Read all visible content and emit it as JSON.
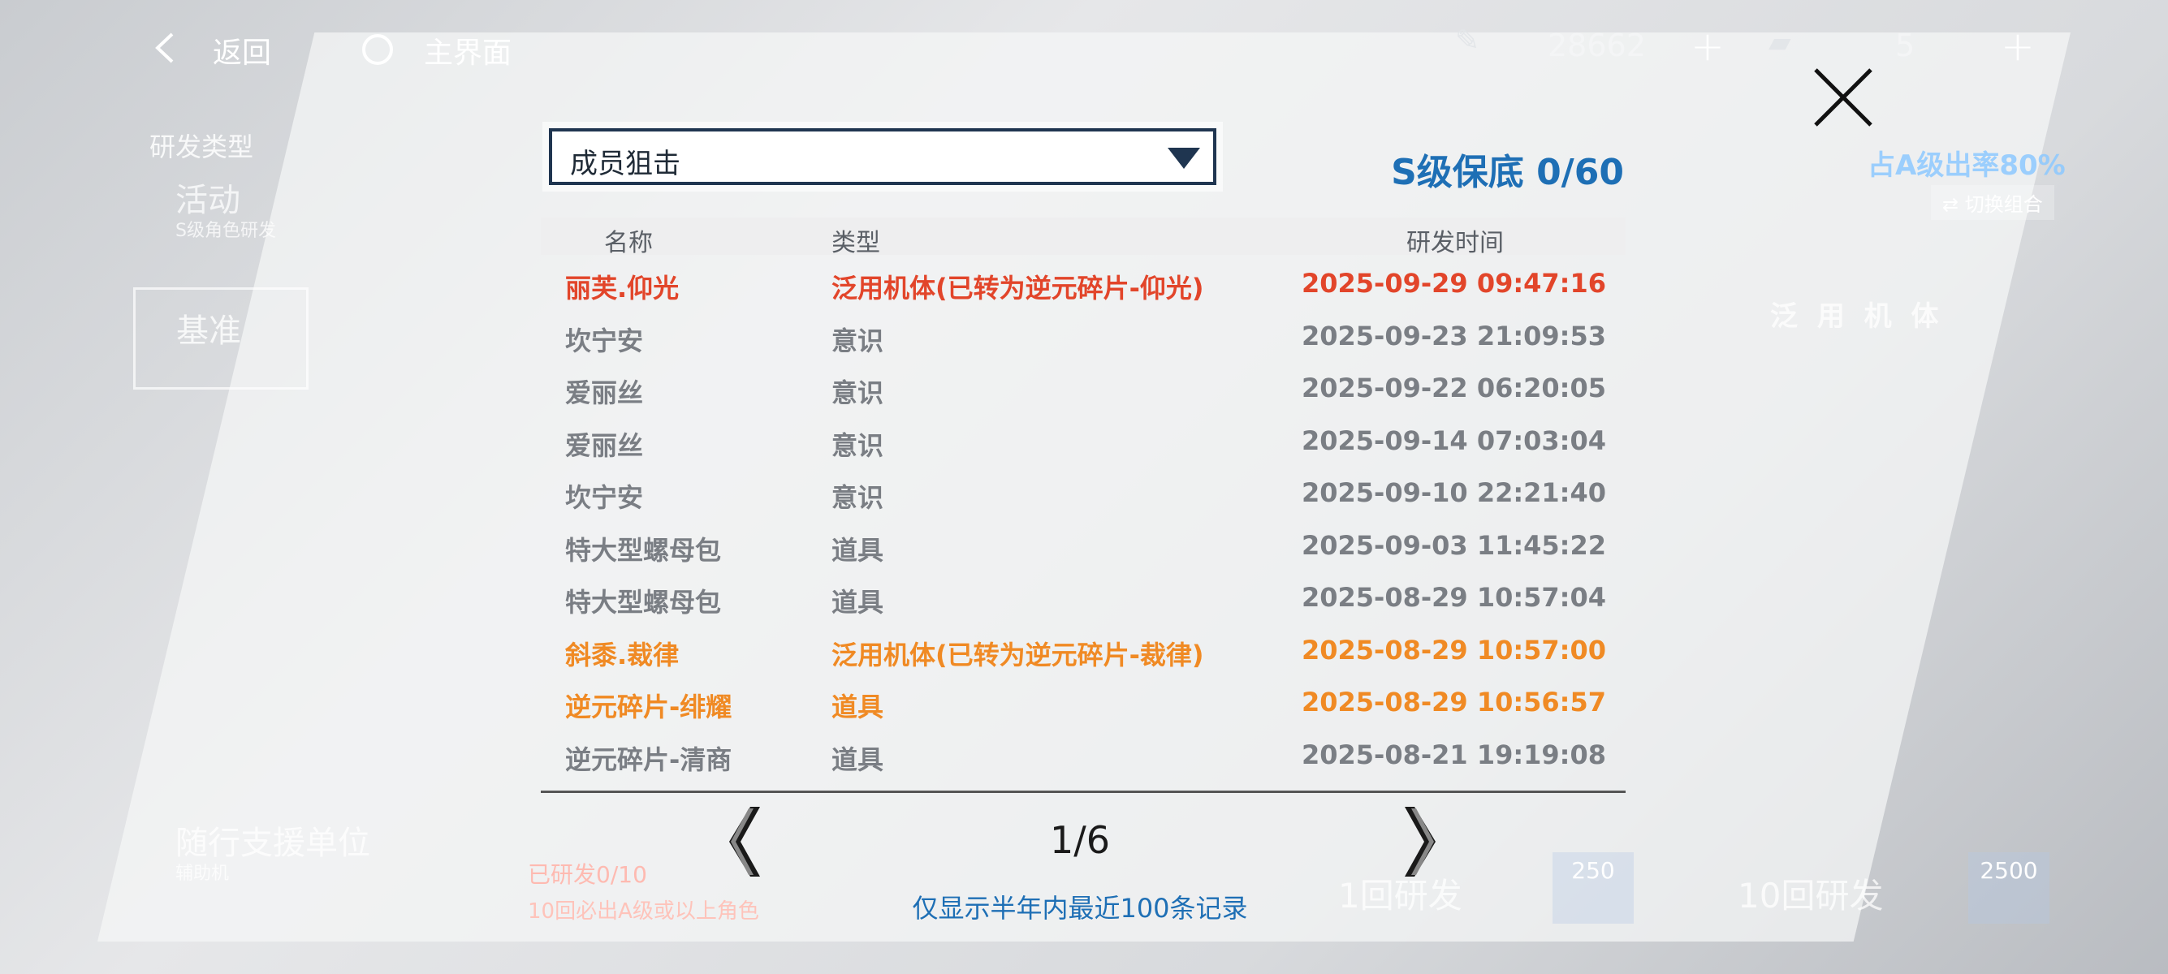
{
  "colors": {
    "rare_red": "#e2452a",
    "rare_orange": "#f08a24",
    "normal_gray": "#7a7e84",
    "accent_blue": "#1e6fb5"
  },
  "topbar": {
    "back_label": "返回",
    "home_label": "主界面",
    "currency1_value": "28662",
    "currency2_value": "5",
    "plus_label": "+",
    "icons": [
      "back-arrow-icon",
      "home-circle-icon",
      "black-card-icon",
      "ticket-icon",
      "close-icon"
    ]
  },
  "background": {
    "research_type": "研发类型",
    "activity": "活动",
    "activity_sub": "S级角色研发",
    "base": "基准",
    "support": "随行支援单位",
    "support_sub": "辅助机",
    "rate_text": "占A级出率80%",
    "switch_combo": "切换组合",
    "general_unit": "泛 用 机 体",
    "draw1": "1回研发",
    "draw1_cost": "250",
    "draw10": "10回研发",
    "draw10_cost": "2500",
    "hint_line1": "已研发0/10",
    "hint_line2": "10回必出A级或以上角色"
  },
  "dialog": {
    "pool_selected": "成员狙击",
    "pity_text": "S级保底 0/60",
    "columns": [
      "名称",
      "类型",
      "研发时间"
    ],
    "rows": [
      {
        "name": "丽芙.仰光",
        "type": "泛用机体(已转为逆元碎片-仰光)",
        "time": "2025-09-29 09:47:16",
        "tier": "rare_red"
      },
      {
        "name": "坎宁安",
        "type": "意识",
        "time": "2025-09-23 21:09:53",
        "tier": "normal_gray"
      },
      {
        "name": "爱丽丝",
        "type": "意识",
        "time": "2025-09-22 06:20:05",
        "tier": "normal_gray"
      },
      {
        "name": "爱丽丝",
        "type": "意识",
        "time": "2025-09-14 07:03:04",
        "tier": "normal_gray"
      },
      {
        "name": "坎宁安",
        "type": "意识",
        "time": "2025-09-10 22:21:40",
        "tier": "normal_gray"
      },
      {
        "name": "特大型螺母包",
        "type": "道具",
        "time": "2025-09-03 11:45:22",
        "tier": "normal_gray"
      },
      {
        "name": "特大型螺母包",
        "type": "道具",
        "time": "2025-08-29 10:57:04",
        "tier": "normal_gray"
      },
      {
        "name": "斜黍.裁律",
        "type": "泛用机体(已转为逆元碎片-裁律)",
        "time": "2025-08-29 10:57:00",
        "tier": "rare_orange"
      },
      {
        "name": "逆元碎片-绯耀",
        "type": "道具",
        "time": "2025-08-29 10:56:57",
        "tier": "rare_orange"
      },
      {
        "name": "逆元碎片-清商",
        "type": "道具",
        "time": "2025-08-21 19:19:08",
        "tier": "normal_gray"
      }
    ],
    "page_current": 1,
    "page_total": 6,
    "page_label": "1/6",
    "note": "仅显示半年内最近100条记录"
  }
}
